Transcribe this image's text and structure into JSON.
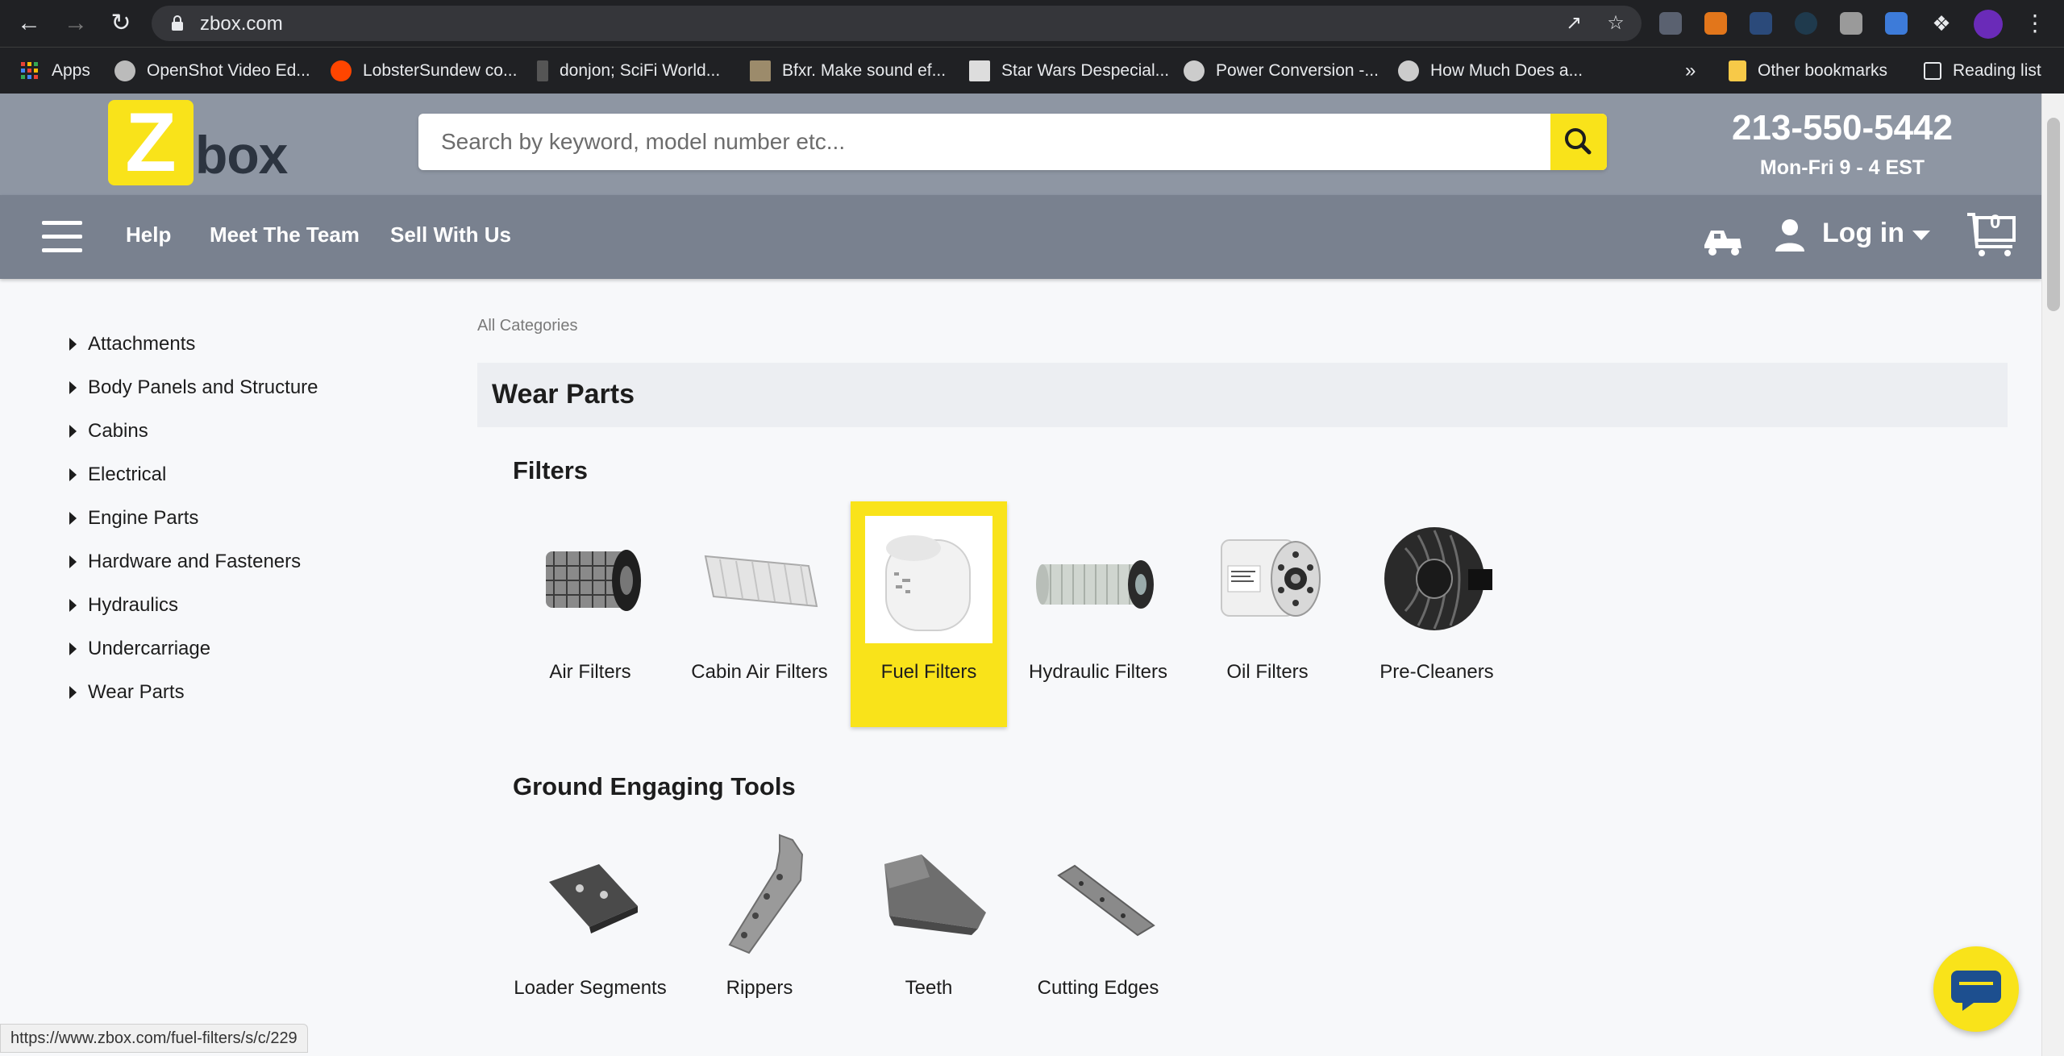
{
  "browser": {
    "url": "zbox.com",
    "bookmarks": [
      {
        "label": "Apps",
        "color": "#e94235"
      },
      {
        "label": "OpenShot Video Ed...",
        "color": "#bbbbbb"
      },
      {
        "label": "LobsterSundew co...",
        "color": "#ff4500"
      },
      {
        "label": "donjon; SciFi World...",
        "color": "#555555"
      },
      {
        "label": "Bfxr. Make sound ef...",
        "color": "#9c8b6b"
      },
      {
        "label": "Star Wars Despecial...",
        "color": "#dddddd"
      },
      {
        "label": "Power Conversion -...",
        "color": "#cccccc"
      },
      {
        "label": "How Much Does a...",
        "color": "#cccccc"
      }
    ],
    "more": "»",
    "other_bookmarks": "Other bookmarks",
    "reading_list": "Reading list"
  },
  "header": {
    "logo_letter": "Z",
    "logo_word": "box",
    "search_placeholder": "Search by keyword, model number etc...",
    "phone": "213-550-5442",
    "hours": "Mon-Fri 9 - 4 EST"
  },
  "nav": {
    "links": [
      "Help",
      "Meet The Team",
      "Sell With Us"
    ],
    "login": "Log in",
    "cart_count": "0"
  },
  "sidebar": {
    "items": [
      "Attachments",
      "Body Panels and Structure",
      "Cabins",
      "Electrical",
      "Engine Parts",
      "Hardware and Fasteners",
      "Hydraulics",
      "Undercarriage",
      "Wear Parts"
    ]
  },
  "main": {
    "breadcrumb": "All Categories",
    "section_title": "Wear Parts",
    "groups": [
      {
        "title": "Filters",
        "items": [
          "Air Filters",
          "Cabin Air Filters",
          "Fuel Filters",
          "Hydraulic Filters",
          "Oil Filters",
          "Pre-Cleaners"
        ]
      },
      {
        "title": "Ground Engaging Tools",
        "items": [
          "Loader Segments",
          "Rippers",
          "Teeth",
          "Cutting Edges"
        ]
      }
    ]
  },
  "status_url": "https://www.zbox.com/fuel-filters/s/c/229",
  "colors": {
    "brand_yellow": "#f9e31a",
    "header_bg": "#8e96a3",
    "nav_bg": "#79818f"
  }
}
